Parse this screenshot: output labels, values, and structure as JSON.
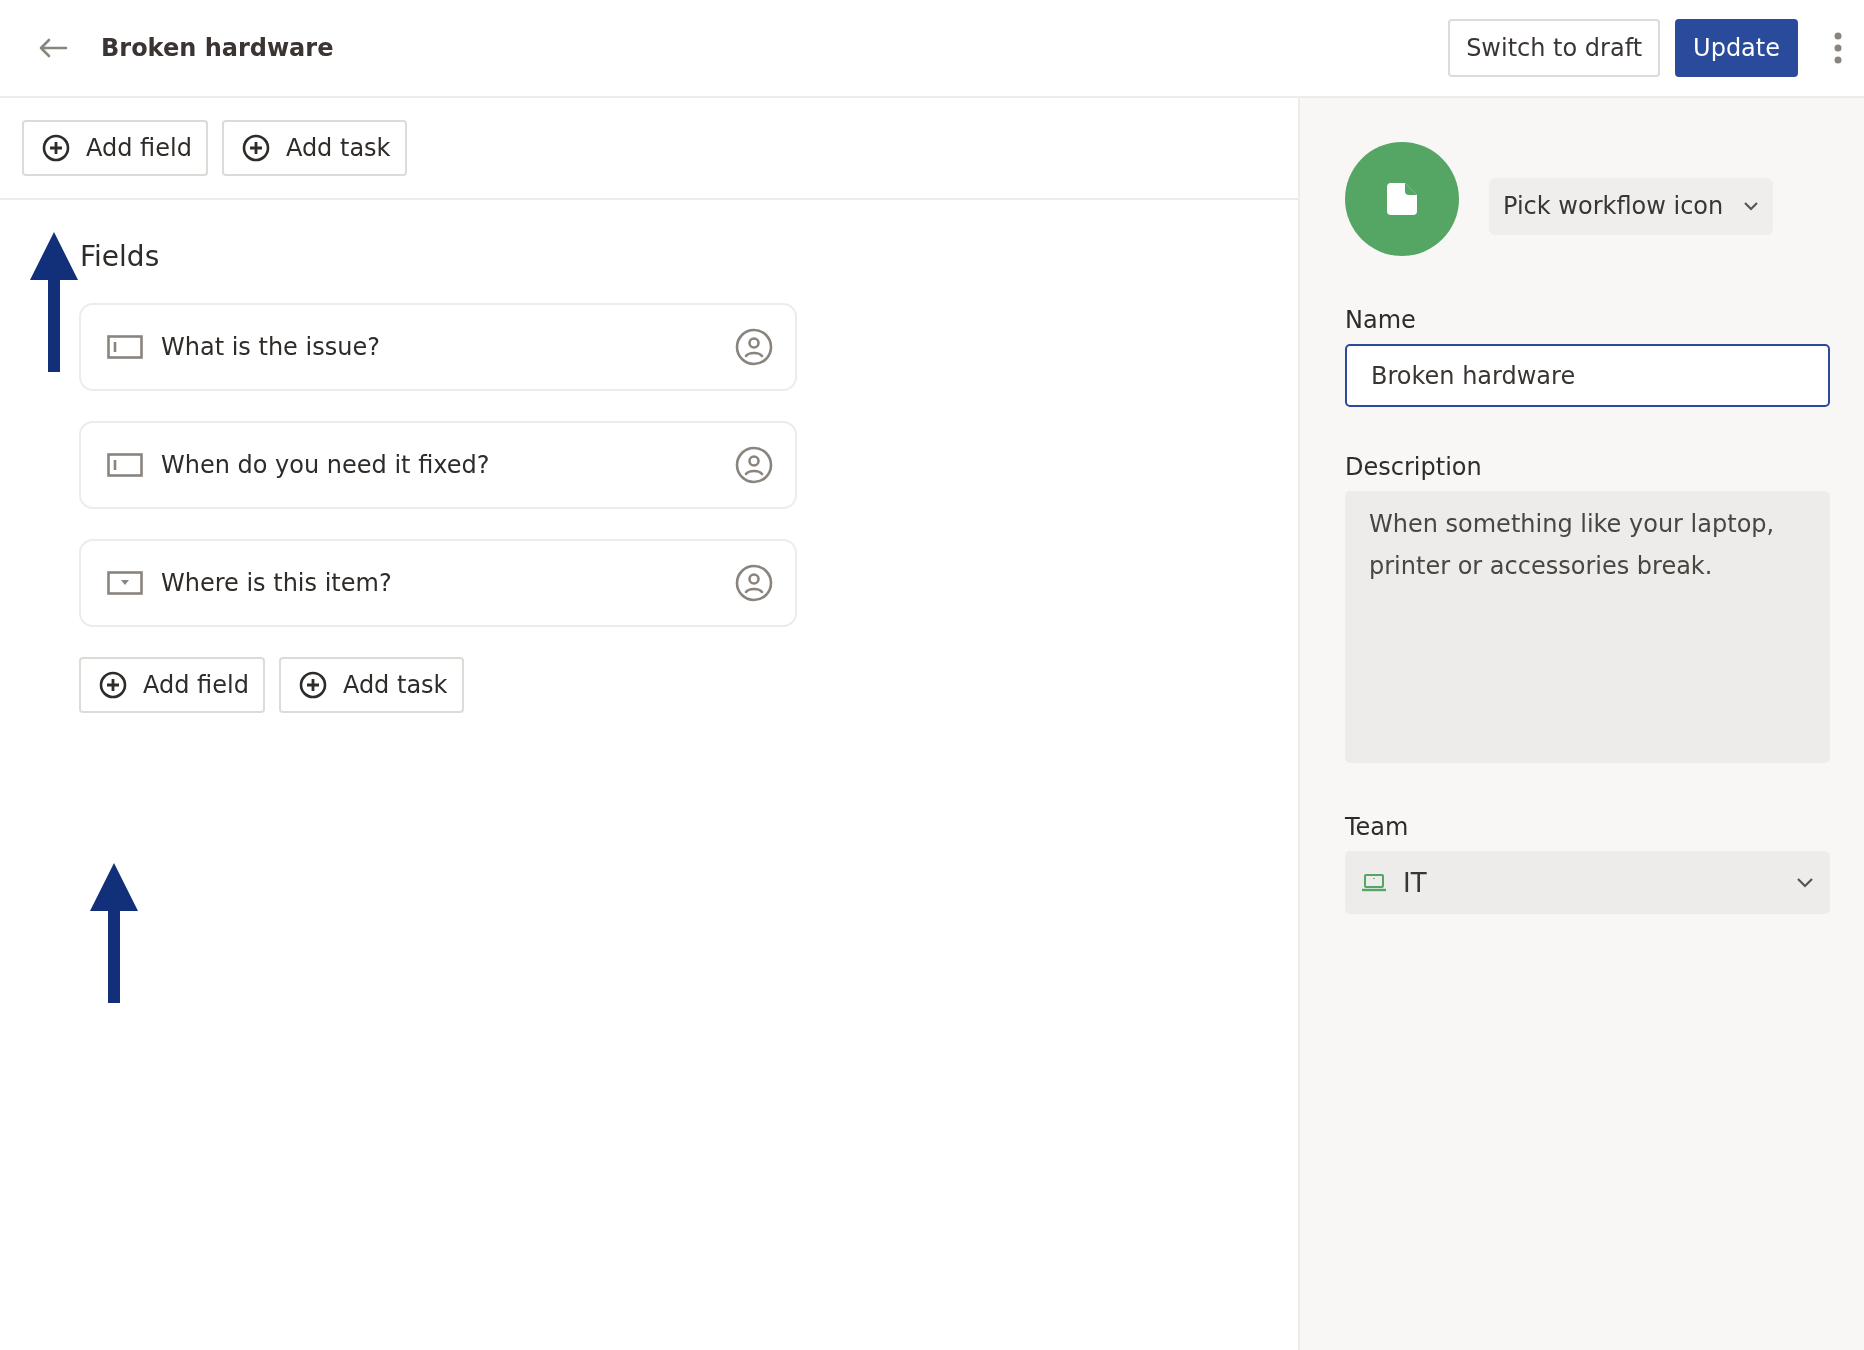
{
  "header": {
    "title": "Broken hardware",
    "buttons": [
      {
        "label": "Switch to draft",
        "kind": "secondary"
      },
      {
        "label": "Update",
        "kind": "primary"
      }
    ]
  },
  "toolbar": {
    "buttons": [
      "Add field",
      "Add task"
    ]
  },
  "fields_section": {
    "heading": "Fields",
    "fields": [
      {
        "label": "What is the issue?",
        "kind": "text"
      },
      {
        "label": "When do you need it fixed?",
        "kind": "text"
      },
      {
        "label": "Where is this item?",
        "kind": "dropdown"
      }
    ],
    "buttons": [
      "Add field",
      "Add task"
    ]
  },
  "sidebar": {
    "icon_button": "Pick workflow icon",
    "name_label": "Name",
    "name_value": "Broken hardware",
    "description_label": "Description",
    "description_value": "When something like your laptop, printer or accessories break.",
    "team_label": "Team",
    "team_value": "IT"
  }
}
